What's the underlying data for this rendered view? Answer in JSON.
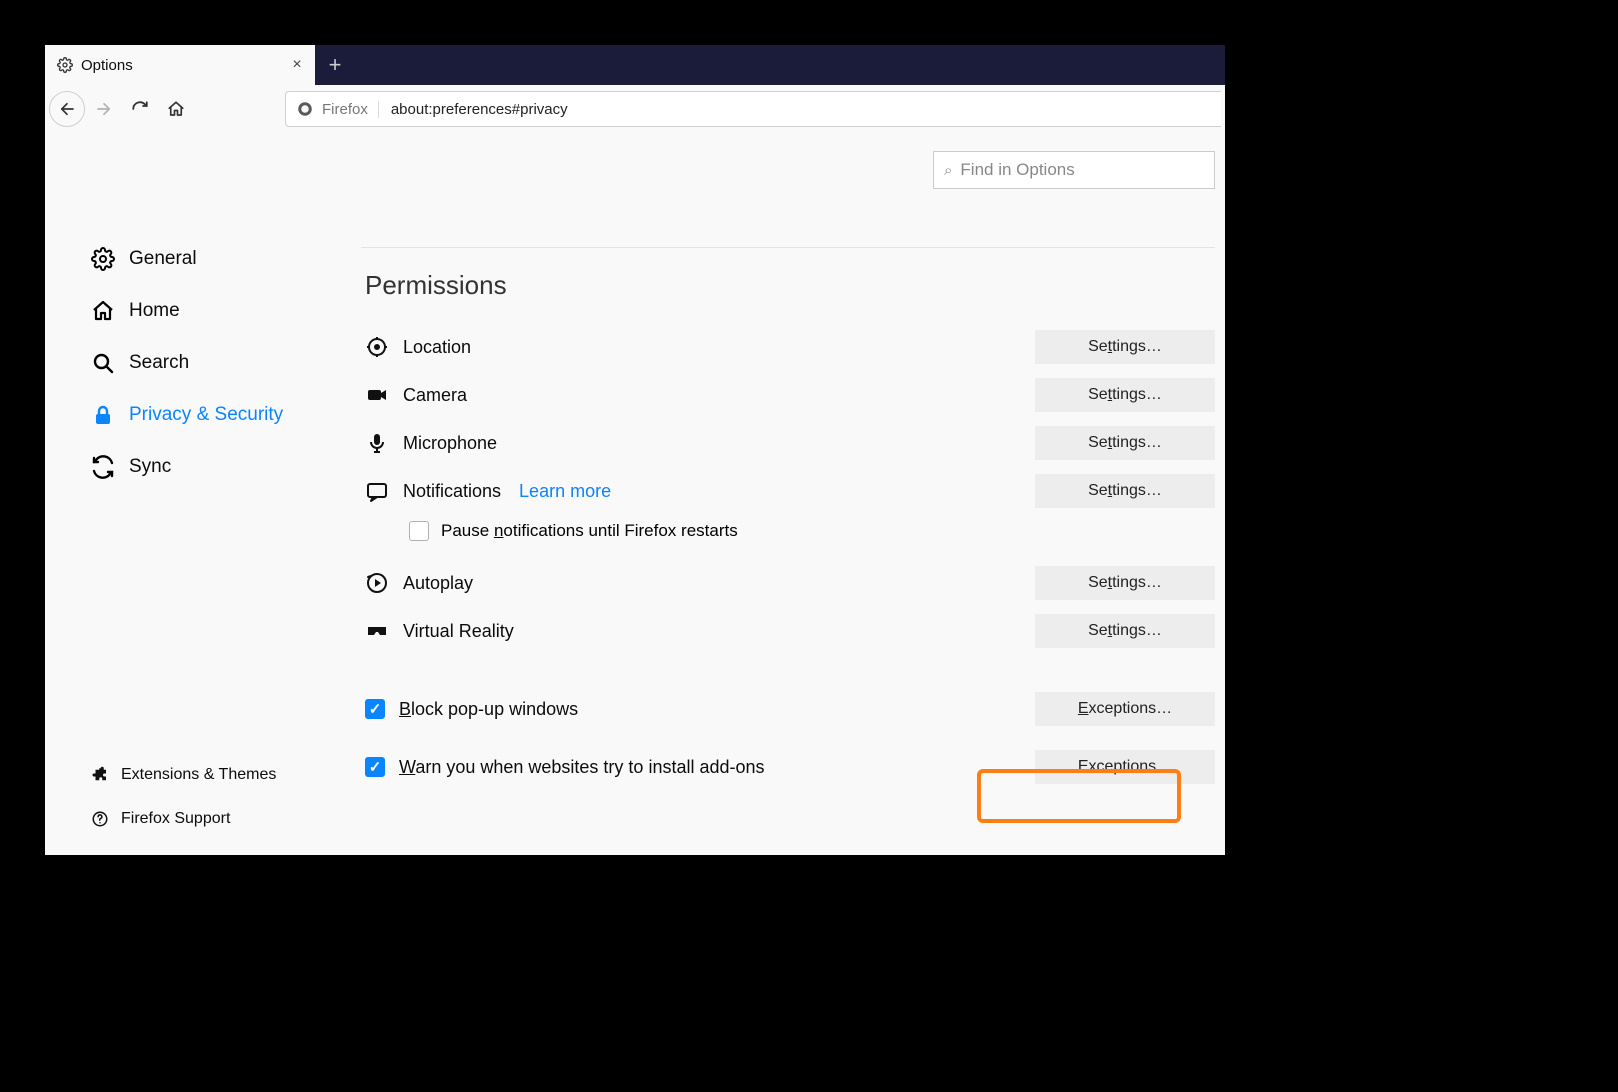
{
  "tab": {
    "title": "Options"
  },
  "urlbar": {
    "identity": "Firefox",
    "url": "about:preferences#privacy"
  },
  "search": {
    "placeholder": "Find in Options"
  },
  "sidebar": {
    "items": [
      {
        "label": "General"
      },
      {
        "label": "Home"
      },
      {
        "label": "Search"
      },
      {
        "label": "Privacy & Security"
      },
      {
        "label": "Sync"
      }
    ],
    "bottom": [
      {
        "label": "Extensions & Themes"
      },
      {
        "label": "Firefox Support"
      }
    ]
  },
  "main": {
    "section_title": "Permissions",
    "settings_label": "Settings…",
    "exceptions_label": "Exceptions…",
    "learn_more": "Learn more",
    "permissions": {
      "location": "Location",
      "camera": "Camera",
      "microphone": "Microphone",
      "notifications": "Notifications",
      "pause_notifications": "Pause notifications until Firefox restarts",
      "autoplay": "Autoplay",
      "vr": "Virtual Reality",
      "block_popups": "Block pop-up windows",
      "warn_addons": "Warn you when websites try to install add-ons"
    },
    "checkboxes": {
      "pause_notifications": false,
      "block_popups": true,
      "warn_addons": true
    }
  },
  "highlight": {
    "target": "exceptions-popups"
  }
}
